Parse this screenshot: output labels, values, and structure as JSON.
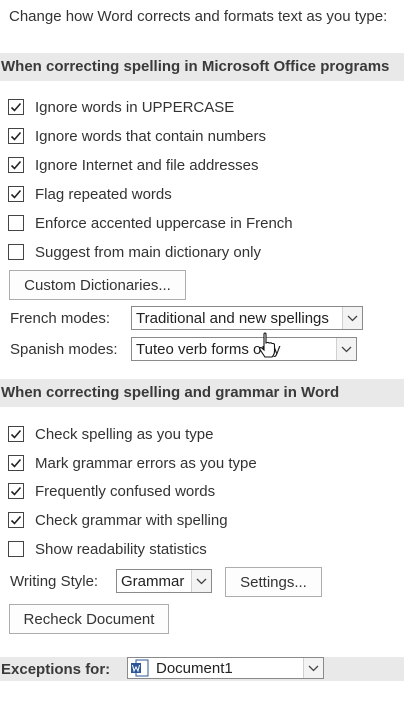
{
  "intro_text": "Change how Word corrects and formats text as you type:",
  "office_section": {
    "title": "When correcting spelling in Microsoft Office programs",
    "options": [
      {
        "label": "Ignore words in UPPERCASE",
        "checked": true
      },
      {
        "label": "Ignore words that contain numbers",
        "checked": true
      },
      {
        "label": "Ignore Internet and file addresses",
        "checked": true
      },
      {
        "label": "Flag repeated words",
        "checked": true
      },
      {
        "label": "Enforce accented uppercase in French",
        "checked": false
      },
      {
        "label": "Suggest from main dictionary only",
        "checked": false
      }
    ],
    "custom_dictionaries_label": "Custom Dictionaries...",
    "french_modes_label": "French modes:",
    "french_modes_value": "Traditional and new spellings",
    "spanish_modes_label": "Spanish modes:",
    "spanish_modes_value": "Tuteo verb forms only"
  },
  "word_section": {
    "title": "When correcting spelling and grammar in Word",
    "options": [
      {
        "label": "Check spelling as you type",
        "checked": true
      },
      {
        "label": "Mark grammar errors as you type",
        "checked": true
      },
      {
        "label": "Frequently confused words",
        "checked": true
      },
      {
        "label": "Check grammar with spelling",
        "checked": true
      },
      {
        "label": "Show readability statistics",
        "checked": false
      }
    ],
    "writing_style_label": "Writing Style:",
    "writing_style_value": "Grammar",
    "settings_label": "Settings...",
    "recheck_label": "Recheck Document"
  },
  "exceptions": {
    "label": "Exceptions for:",
    "document_value": "Document1"
  }
}
